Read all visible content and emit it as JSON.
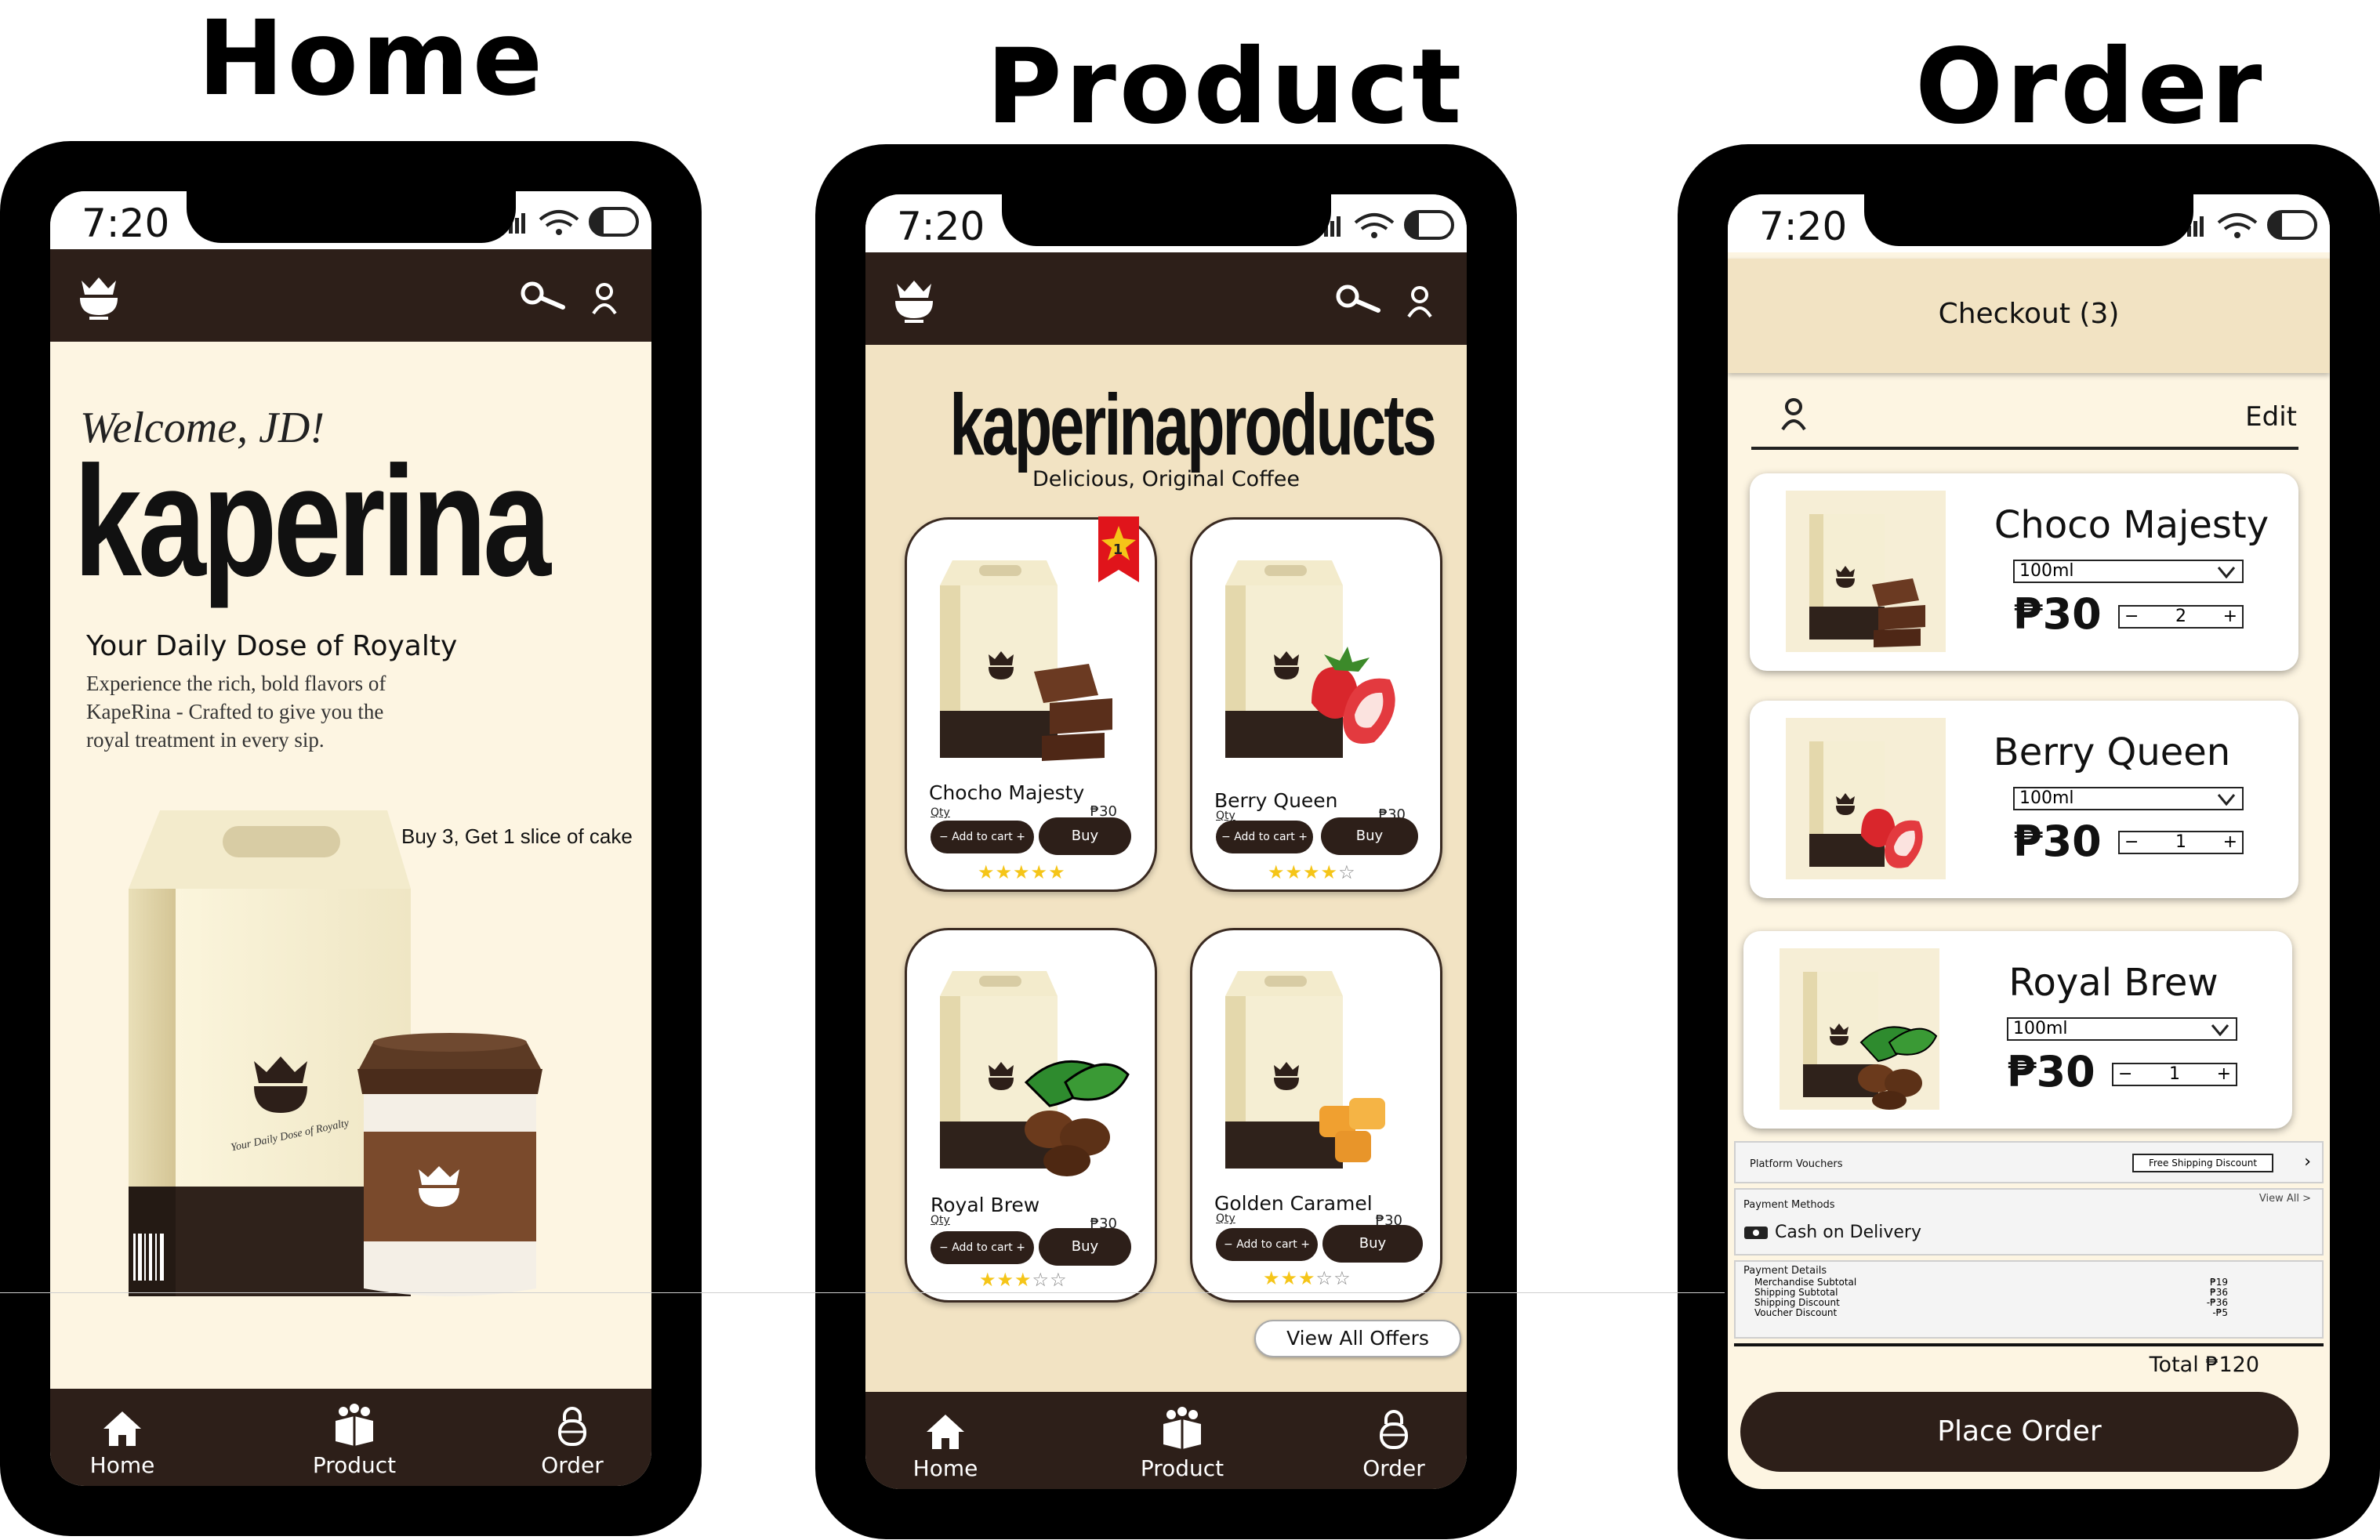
{
  "titles": {
    "home": "Home",
    "product": "Product",
    "order": "Order"
  },
  "status": {
    "time": "7:20"
  },
  "nav": {
    "home": "Home",
    "product": "Product",
    "order": "Order"
  },
  "home": {
    "welcome": "Welcome, JD!",
    "brand": "kaperina",
    "tagline": "Your Daily Dose of Royalty",
    "description": "Experience the rich, bold flavors of KapeRina - Crafted to give you the royal treatment in every sip.",
    "promo": "Buy 3, Get 1 slice of cake"
  },
  "product": {
    "heading": "kaperinaproducts",
    "subheading": "Delicious, Original Coffee",
    "qty_label": "Qty",
    "add_to_cart": "Add to cart",
    "buy": "Buy",
    "badge": "1",
    "items": [
      {
        "name": "Chocho Majesty",
        "price": "₱30",
        "rating": 5
      },
      {
        "name": "Berry Queen",
        "price": "₱30",
        "rating": 4
      },
      {
        "name": "Royal Brew",
        "price": "₱30",
        "rating": 3
      },
      {
        "name": "Golden Caramel",
        "price": "₱30",
        "rating": 3
      }
    ],
    "view_all": "View All Offers"
  },
  "order": {
    "title": "Checkout (3)",
    "edit": "Edit",
    "items": [
      {
        "name": "Choco Majesty",
        "size": "100ml",
        "price": "₱30",
        "qty": "2"
      },
      {
        "name": "Berry Queen",
        "size": "100ml",
        "price": "₱30",
        "qty": "1"
      },
      {
        "name": "Royal Brew",
        "size": "100ml",
        "price": "₱30",
        "qty": "1"
      }
    ],
    "vouchers_label": "Platform Vouchers",
    "voucher_tag": "Free Shipping Discount",
    "payment_label": "Payment Methods",
    "view_all": "View All >",
    "payment_value": "Cash on Delivery",
    "details_label": "Payment Details",
    "details": [
      {
        "label": "Merchandise Subtotal",
        "value": "₱19"
      },
      {
        "label": "Shipping Subtotal",
        "value": "₱36"
      },
      {
        "label": "Shipping Discount",
        "value": "-₱36"
      },
      {
        "label": "Voucher Discount",
        "value": "-₱5"
      }
    ],
    "total": "Total ₱120",
    "place_order": "Place Order"
  },
  "colors": {
    "dark_brown": "#2d1f19",
    "cream": "#fdf5e2",
    "beige": "#f2e3c3",
    "star": "#f5c518",
    "ribbon": "#e0141b"
  }
}
